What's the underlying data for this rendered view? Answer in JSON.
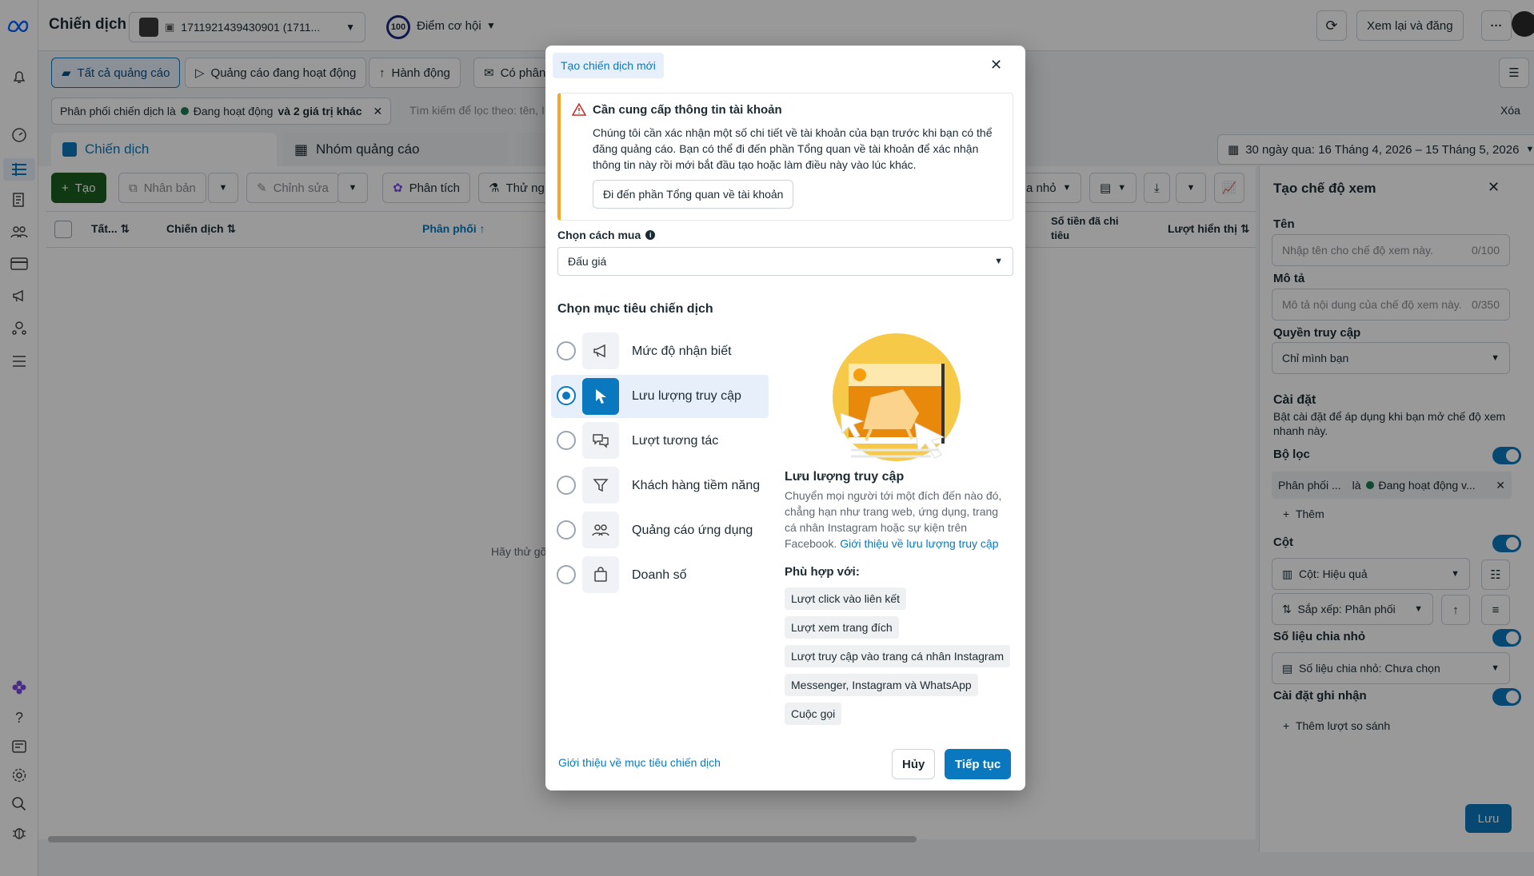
{
  "header": {
    "title": "Chiến dịch",
    "account_id": "1711921439430901 (1711...",
    "opportunity_score": "100",
    "opportunity_label": "Điểm cơ hội",
    "review_publish": "Xem lại và đăng"
  },
  "tabs_row": {
    "all_ads": "Tất cả quảng cáo",
    "active_ads": "Quảng cáo đang hoạt động",
    "actions": "Hành động",
    "has_delivery": "Có phân"
  },
  "filter": {
    "chip_prefix": "Phân phối chiến dịch là",
    "chip_value": "Đang hoạt động",
    "chip_suffix": "và 2 giá trị khác",
    "search_placeholder": "Tìm kiếm để lọc theo: tên, I",
    "clear": "Xóa"
  },
  "level_tabs": {
    "campaigns": "Chiến dịch",
    "adsets": "Nhóm quảng cáo"
  },
  "date_range": "30 ngày qua: 16 Tháng 4, 2026 – 15 Tháng 5, 2026",
  "toolbar": {
    "create": "Tạo",
    "duplicate": "Nhân bản",
    "edit": "Chỉnh sửa",
    "analyze": "Phân tích",
    "test": "Thử ng",
    "breakdown": "a nhỏ"
  },
  "table": {
    "col_all": "Tất...",
    "col_campaign": "Chiến dịch",
    "col_delivery": "Phân phối",
    "col_spent": "Số tiền đã chi tiêu",
    "col_impressions": "Lượt hiển thị",
    "empty_hint": "Hãy thử gỡ"
  },
  "modal": {
    "badge": "Tạo chiến dịch mới",
    "warning_title": "Cần cung cấp thông tin tài khoản",
    "warning_body": "Chúng tôi cần xác nhận một số chi tiết về tài khoản của bạn trước khi bạn có thể đăng quảng cáo. Bạn có thể đi đến phần Tổng quan về tài khoản để xác nhận thông tin này rồi mới bắt đầu tạo hoặc làm điều này vào lúc khác.",
    "warning_button": "Đi đến phần Tổng quan về tài khoản",
    "buy_label": "Chọn cách mua",
    "buy_value": "Đấu giá",
    "objective_heading": "Chọn mục tiêu chiến dịch",
    "objectives": [
      {
        "label": "Mức độ nhận biết",
        "icon": "megaphone-icon",
        "selected": false
      },
      {
        "label": "Lưu lượng truy cập",
        "icon": "cursor-icon",
        "selected": true
      },
      {
        "label": "Lượt tương tác",
        "icon": "chat-bubbles-icon",
        "selected": false
      },
      {
        "label": "Khách hàng tiềm năng",
        "icon": "filter-icon",
        "selected": false
      },
      {
        "label": "Quảng cáo ứng dụng",
        "icon": "people-icon",
        "selected": false
      },
      {
        "label": "Doanh số",
        "icon": "shopping-bag-icon",
        "selected": false
      }
    ],
    "detail_title": "Lưu lượng truy cập",
    "detail_body": "Chuyển mọi người tới một đích đến nào đó, chẳng hạn như trang web, ứng dụng, trang cá nhân Instagram hoặc sự kiện trên Facebook.",
    "detail_link": "Giới thiệu về lưu lượng truy cập",
    "fits_label": "Phù hợp với:",
    "chips": [
      "Lượt click vào liên kết",
      "Lượt xem trang đích",
      "Lượt truy cập vào trang cá nhân Instagram",
      "Messenger, Instagram và WhatsApp",
      "Cuộc gọi"
    ],
    "footer_link": "Giới thiệu về mục tiêu chiến dịch",
    "cancel": "Hủy",
    "continue": "Tiếp tục"
  },
  "right_panel": {
    "title": "Tạo chế độ xem",
    "name_label": "Tên",
    "name_placeholder": "Nhập tên cho chế độ xem này.",
    "name_count": "0/100",
    "desc_label": "Mô tả",
    "desc_placeholder": "Mô tả nội dung của chế độ xem này.",
    "desc_count": "0/350",
    "access_label": "Quyền truy cập",
    "access_value": "Chỉ mình bạn",
    "settings_title": "Cài đặt",
    "settings_desc": "Bật cài đặt để áp dụng khi bạn mở chế độ xem nhanh này.",
    "filter_label": "Bộ lọc",
    "filter_chip_a": "Phân phối ...",
    "filter_chip_b": "là",
    "filter_chip_c": "Đang hoạt động v...",
    "add": "Thêm",
    "columns_label": "Cột",
    "columns_value": "Cột: Hiệu quả",
    "sort_value": "Sắp xếp: Phân phối",
    "breakdown_label": "Số liệu chia nhỏ",
    "breakdown_value": "Số liệu chia nhỏ: Chưa chọn",
    "attribution_label": "Cài đặt ghi nhận",
    "add_compare": "Thêm lượt so sánh",
    "save": "Lưu"
  },
  "colors": {
    "primary": "#0a78be",
    "create_green": "#1b5e20",
    "warning": "#f5a623"
  }
}
